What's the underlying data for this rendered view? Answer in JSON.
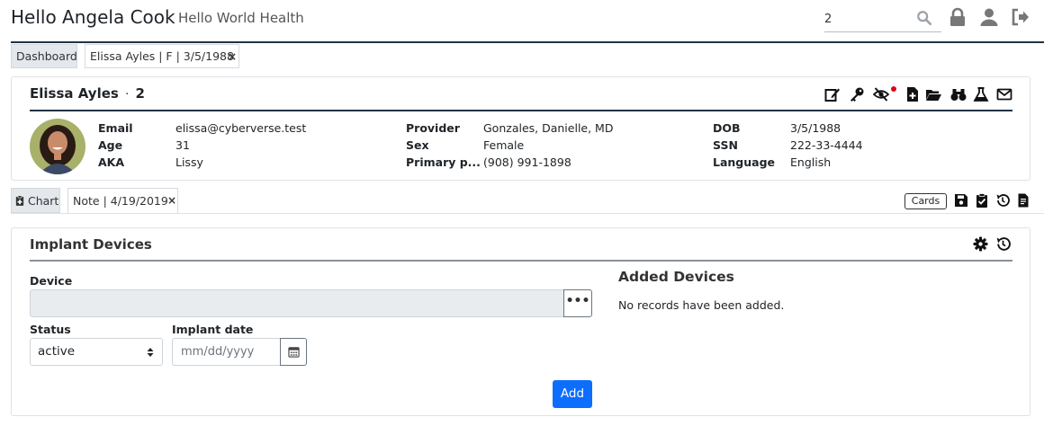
{
  "header": {
    "greeting": "Hello Angela Cook",
    "separator": "·",
    "org": "Hello World Health",
    "search_value": "2"
  },
  "tabs": {
    "dashboard": "Dashboard",
    "patient": "Elissa Ayles | F | 3/5/1988",
    "close": "×"
  },
  "patient": {
    "name": "Elissa Ayles",
    "separator": "·",
    "id": "2",
    "fields": {
      "email_label": "Email",
      "email": "elissa@cyberverse.test",
      "age_label": "Age",
      "age": "31",
      "aka_label": "AKA",
      "aka": "Lissy",
      "provider_label": "Provider",
      "provider": "Gonzales, Danielle, MD",
      "sex_label": "Sex",
      "sex": "Female",
      "pharmacy_label": "Primary p...",
      "pharmacy": "(908) 991-1898",
      "dob_label": "DOB",
      "dob": "3/5/1988",
      "ssn_label": "SSN",
      "ssn": "222-33-4444",
      "language_label": "Language",
      "language": "English"
    }
  },
  "subtabs": {
    "chart": "Chart",
    "note": "Note | 4/19/2019",
    "close": "×",
    "cards": "Cards"
  },
  "implant": {
    "title": "Implant Devices",
    "device_label": "Device",
    "device_button": "•••",
    "status_label": "Status",
    "status_value": "active",
    "implant_date_label": "Implant date",
    "implant_date_placeholder": "mm/dd/yyyy",
    "added_title": "Added Devices",
    "added_empty": "No records have been added.",
    "add_button": "Add"
  },
  "colors": {
    "accent": "#0d6efd",
    "rule": "#223344",
    "notification": "#e0001b"
  }
}
